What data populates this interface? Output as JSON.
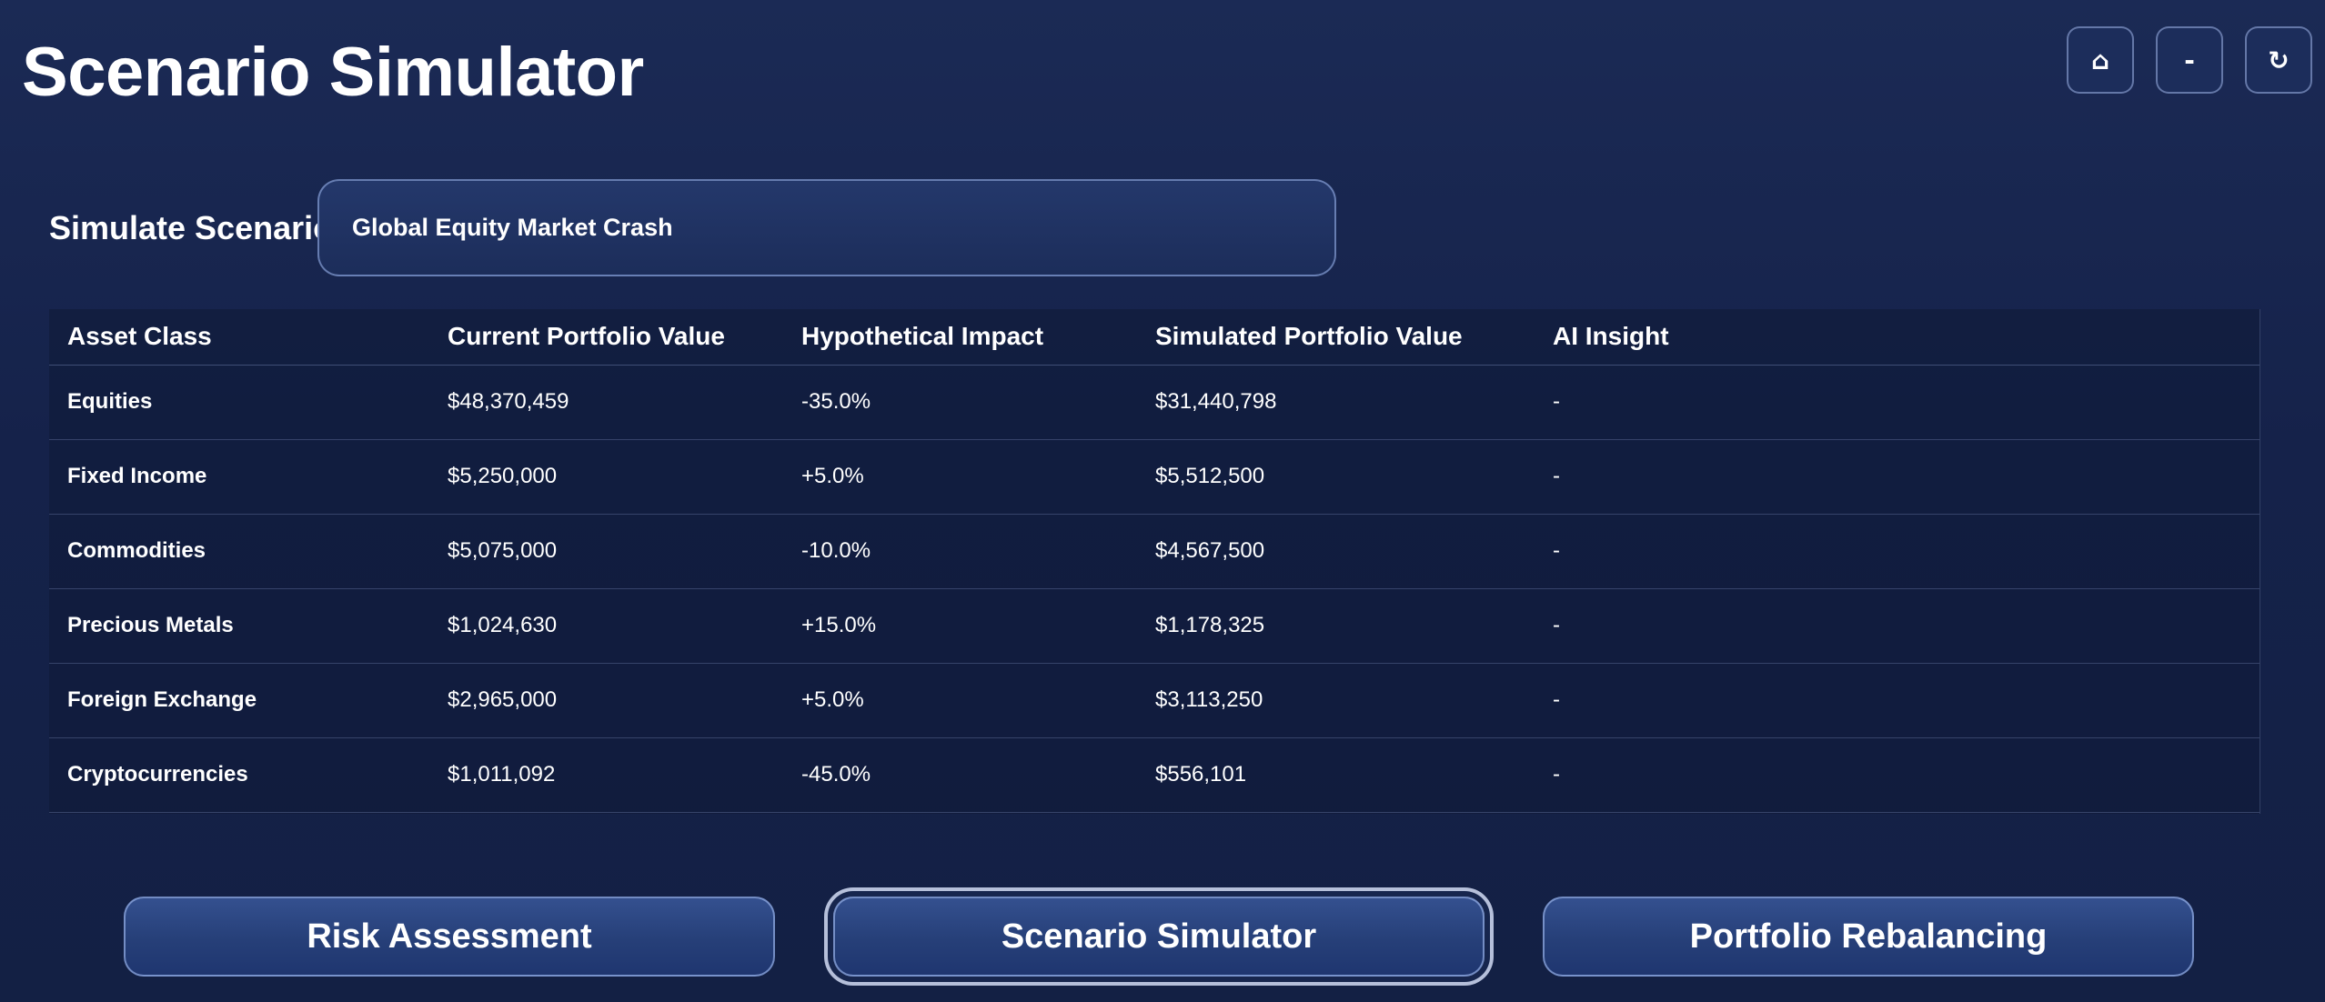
{
  "page": {
    "title": "Scenario Simulator"
  },
  "window_controls": {
    "home_glyph": "⌂",
    "minimize_glyph": "-",
    "refresh_glyph": "↻"
  },
  "scenario": {
    "label": "Simulate Scenario:",
    "selected_value": "Global Equity Market Crash"
  },
  "table": {
    "headers": [
      "Asset Class",
      "Current Portfolio Value",
      "Hypothetical Impact",
      "Simulated Portfolio Value",
      "AI Insight"
    ],
    "rows": [
      {
        "asset": "Equities",
        "current": "$48,370,459",
        "impact": "-35.0%",
        "simulated": "$31,440,798",
        "insight": "-"
      },
      {
        "asset": "Fixed Income",
        "current": "$5,250,000",
        "impact": "+5.0%",
        "simulated": "$5,512,500",
        "insight": "-"
      },
      {
        "asset": "Commodities",
        "current": "$5,075,000",
        "impact": "-10.0%",
        "simulated": "$4,567,500",
        "insight": "-"
      },
      {
        "asset": "Precious Metals",
        "current": "$1,024,630",
        "impact": "+15.0%",
        "simulated": "$1,178,325",
        "insight": "-"
      },
      {
        "asset": "Foreign Exchange",
        "current": "$2,965,000",
        "impact": "+5.0%",
        "simulated": "$3,113,250",
        "insight": "-"
      },
      {
        "asset": "Cryptocurrencies",
        "current": "$1,011,092",
        "impact": "-45.0%",
        "simulated": "$556,101",
        "insight": "-"
      }
    ]
  },
  "bottom_nav": {
    "items": [
      {
        "label": "Risk Assessment",
        "active": false
      },
      {
        "label": "Scenario Simulator",
        "active": true
      },
      {
        "label": "Portfolio Rebalancing",
        "active": false
      }
    ]
  },
  "colors": {
    "background": "#16244c",
    "button_fill": "#2b4585",
    "button_border": "#96afe6"
  }
}
